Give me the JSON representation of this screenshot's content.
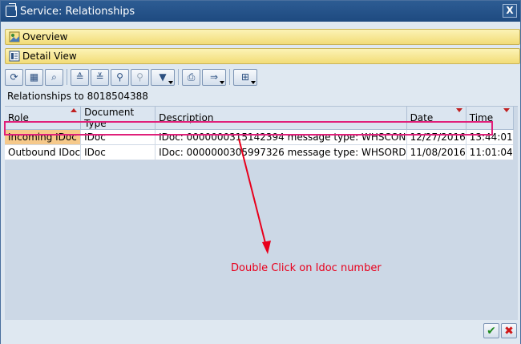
{
  "window": {
    "title": "Service: Relationships",
    "close_label": "X"
  },
  "bars": {
    "overview": "Overview",
    "detail_view": "Detail View"
  },
  "toolbar": {
    "buttons": [
      "refresh-icon",
      "layout-icon",
      "zoom-icon",
      "sort-ascending-icon",
      "sort-descending-icon",
      "find-icon",
      "find-next-icon",
      "filter-icon",
      "print-icon",
      "export-icon",
      "grid-settings-icon"
    ]
  },
  "relationships_label": "Relationships to 8018504388",
  "table": {
    "columns": [
      "Role",
      "Document Type",
      "Description",
      "Date",
      "Time"
    ],
    "rows": [
      {
        "role": "Incoming IDoc",
        "doc_type": "IDoc",
        "description": "IDoc: 0000000315142394 message type: WHSCON",
        "date": "12/27/2016",
        "time": "13:44:01"
      },
      {
        "role": "Outbound IDoc",
        "doc_type": "IDoc",
        "description": "IDoc: 0000000305997326 message type: WHSORD",
        "date": "11/08/2016",
        "time": "11:01:04"
      }
    ]
  },
  "annotation": "Double Click on Idoc number",
  "colors": {
    "title_bar": "#1e4a80",
    "highlight_box": "#e0207a",
    "annotation": "#e8001c",
    "selected_cell": "#f6c98a"
  }
}
